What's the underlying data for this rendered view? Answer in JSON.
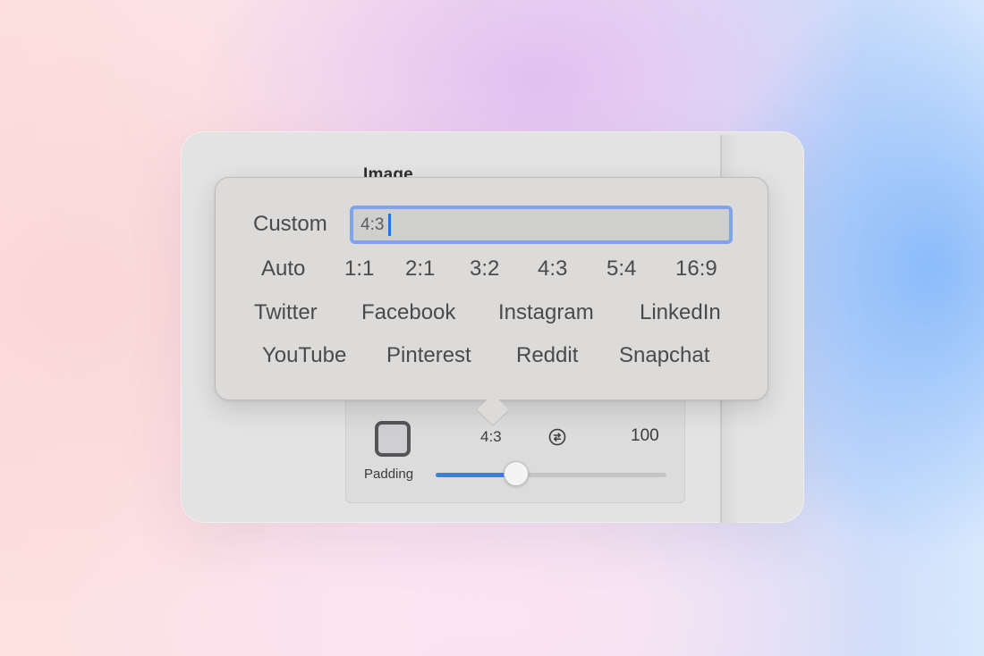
{
  "panel": {
    "section_title": "Image",
    "aspect_ratio": "4:3",
    "value": "100",
    "padding_label": "Padding",
    "padding_slider_fraction": 0.35
  },
  "popover": {
    "custom_label": "Custom",
    "custom_value": "4:3",
    "ratios": [
      "Auto",
      "1:1",
      "2:1",
      "3:2",
      "4:3",
      "5:4",
      "16:9"
    ],
    "social_row_1": [
      "Twitter",
      "Facebook",
      "Instagram",
      "LinkedIn"
    ],
    "social_row_2": [
      "YouTube",
      "Pinterest",
      "Reddit",
      "Snapchat"
    ]
  },
  "icons": {
    "swap": "swap-arrows-circle-icon",
    "swatch": "background-swatch-icon"
  },
  "colors": {
    "accent": "#3e7ce9",
    "focus_ring": "#7fa3ec"
  }
}
